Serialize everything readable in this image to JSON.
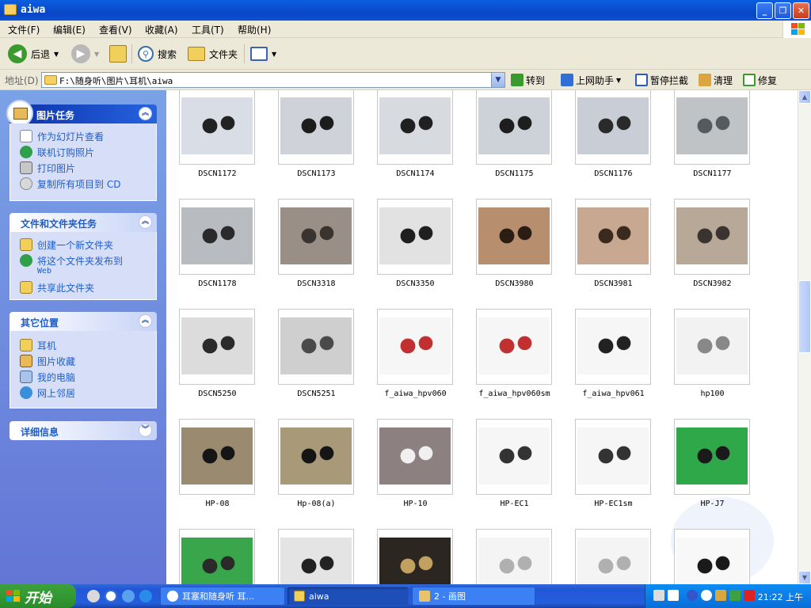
{
  "window": {
    "title": "aiwa"
  },
  "menu": [
    "文件(F)",
    "编辑(E)",
    "查看(V)",
    "收藏(A)",
    "工具(T)",
    "帮助(H)"
  ],
  "toolbar": {
    "back": "后退",
    "search": "搜索",
    "folders": "文件夹"
  },
  "address": {
    "label": "地址(D)",
    "path": "F:\\随身听\\图片\\耳机\\aiwa",
    "go": "转到",
    "assistant": "上网助手",
    "block_popup": "暂停拦截",
    "clean": "清理",
    "repair": "修复"
  },
  "tasks": {
    "picture": {
      "title": "图片任务",
      "items": [
        "作为幻灯片查看",
        "联机订购照片",
        "打印图片",
        "复制所有项目到 CD"
      ]
    },
    "file": {
      "title": "文件和文件夹任务",
      "items": [
        "创建一个新文件夹",
        "将这个文件夹发布到",
        "共享此文件夹"
      ],
      "publish_sub": "Web"
    },
    "places": {
      "title": "其它位置",
      "items": [
        "耳机",
        "图片收藏",
        "我的电脑",
        "网上邻居"
      ]
    },
    "details": {
      "title": "详细信息"
    }
  },
  "files": [
    "DSCN1172",
    "DSCN1173",
    "DSCN1174",
    "DSCN1175",
    "DSCN1176",
    "DSCN1177",
    "DSCN1178",
    "DSCN3318",
    "DSCN3350",
    "DSCN3980",
    "DSCN3981",
    "DSCN3982",
    "DSCN5250",
    "DSCN5251",
    "f_aiwa_hpv060",
    "f_aiwa_hpv060sm",
    "f_aiwa_hpv061",
    "hp100",
    "HP-08",
    "Hp-08(a)",
    "HP-10",
    "HP-EC1",
    "HP-EC1sm",
    "HP-J7",
    "",
    "",
    "",
    "",
    "",
    ""
  ],
  "thumb_colors": [
    [
      "#d9dde6",
      "#222222"
    ],
    [
      "#cfd3d9",
      "#1c1c1c"
    ],
    [
      "#d7dadf",
      "#202020"
    ],
    [
      "#cdd2d8",
      "#1e1e1e"
    ],
    [
      "#c9ced6",
      "#2a2a2a"
    ],
    [
      "#bfc3c6",
      "#555a5e"
    ],
    [
      "#b8bcc0",
      "#2a2a2a"
    ],
    [
      "#9a8f86",
      "#3a3430"
    ],
    [
      "#e2e2e2",
      "#1f1f1f"
    ],
    [
      "#b88f6e",
      "#2b1d14"
    ],
    [
      "#c8a890",
      "#3a2a1e"
    ],
    [
      "#b8a898",
      "#3a3430"
    ],
    [
      "#dcdcdc",
      "#2a2a2a"
    ],
    [
      "#cfcfcf",
      "#4a4a4a"
    ],
    [
      "#f6f6f6",
      "#c03030"
    ],
    [
      "#f6f6f6",
      "#c03030"
    ],
    [
      "#f6f6f6",
      "#222222"
    ],
    [
      "#f2f2f2",
      "#888888"
    ],
    [
      "#9a8a70",
      "#151515"
    ],
    [
      "#a89a78",
      "#151515"
    ],
    [
      "#8d8080",
      "#f0f0f0"
    ],
    [
      "#f6f6f6",
      "#333333"
    ],
    [
      "#f6f6f6",
      "#333333"
    ],
    [
      "#2fa84a",
      "#1a1a1a"
    ],
    [
      "#3aa64c",
      "#2a2a2a"
    ],
    [
      "#e4e4e4",
      "#222222"
    ],
    [
      "#2b2620",
      "#c2a060"
    ],
    [
      "#f4f4f4",
      "#b0b0b0"
    ],
    [
      "#f4f4f4",
      "#b0b0b0"
    ],
    [
      "#f8f8f8",
      "#1a1a1a"
    ]
  ],
  "taskbar": {
    "start": "开始",
    "tasks": [
      "耳塞和随身听 耳...",
      "aiwa",
      "2 - 画图"
    ],
    "clock": "21:22 上午"
  }
}
